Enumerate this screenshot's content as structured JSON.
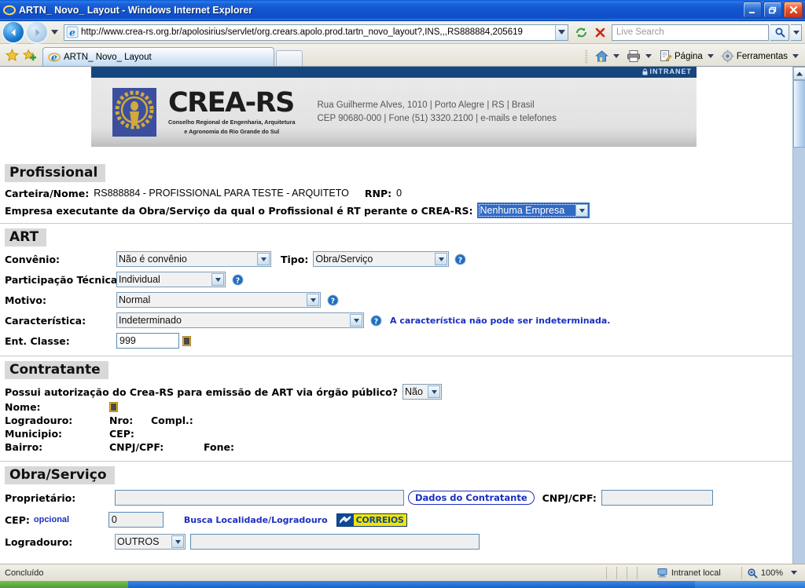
{
  "window": {
    "title": "ARTN_ Novo_ Layout - Windows Internet Explorer",
    "minimize_label": "Minimizar",
    "restore_label": "Restaurar",
    "close_label": "Fechar"
  },
  "navbar": {
    "back_label": "Voltar",
    "forward_label": "Avançar",
    "recent_label": "Páginas recentes",
    "url": "http://www.crea-rs.org.br/apolosirius/servlet/org.crears.apolo.prod.tartn_novo_layout?,INS,,,RS888884,205619",
    "refresh_label": "Atualizar",
    "stop_label": "Parar",
    "search_placeholder": "Live Search",
    "search_value": "",
    "search_go_label": "Pesquisar"
  },
  "tabbar": {
    "favorites_label": "Favoritos",
    "add_favorite_label": "Adicionar a Favoritos",
    "tab_title": "ARTN_ Novo_ Layout",
    "new_tab_label": "Nova Guia",
    "home_label": "Página Inicial",
    "print_label": "Imprimir",
    "page_menu": "Página",
    "tools_menu": "Ferramentas"
  },
  "crea_header": {
    "intranet_label": "INTRANET",
    "brand": "CREA-RS",
    "brand_sub_line1": "Conselho Regional de Engenharia, Arquitetura",
    "brand_sub_line2": "e Agronomia do Rio Grande do Sul",
    "address_line1": "Rua Guilherme Alves, 1010 | Porto Alegre | RS | Brasil",
    "address_line2": "CEP 90680-000 | Fone (51) 3320.2100 | e-mails e telefones"
  },
  "profissional": {
    "heading": "Profissional",
    "carteira_label": "Carteira/Nome:",
    "carteira_value": "RS888884  -  PROFISSIONAL PARA TESTE - ARQUITETO",
    "rnp_label": "RNP:",
    "rnp_value": "0",
    "empresa_label": "Empresa executante da Obra/Serviço da qual o Profissional é RT perante o CREA-RS:",
    "empresa_value": "Nenhuma Empresa"
  },
  "art": {
    "heading": "ART",
    "convenio_label": "Convênio:",
    "convenio_value": "Não é convênio",
    "tipo_label": "Tipo:",
    "tipo_value": "Obra/Serviço",
    "participacao_label": "Participação Técnica:",
    "participacao_value": "Individual",
    "motivo_label": "Motivo:",
    "motivo_value": "Normal",
    "caracteristica_label": "Característica:",
    "caracteristica_value": "Indeterminado",
    "caracteristica_warning": "A característica não pode ser indeterminada.",
    "ent_classe_label": "Ent. Classe:",
    "ent_classe_value": "999"
  },
  "contratante": {
    "heading": "Contratante",
    "autorizacao_label": "Possui autorização do Crea-RS para emissão de ART via órgão público?",
    "autorizacao_value": "Não",
    "nome_label": "Nome:",
    "nome_value": "",
    "logradouro_label": "Logradouro:",
    "logradouro_value": "",
    "nro_label": "Nro:",
    "nro_value": "",
    "compl_label": "Compl.:",
    "compl_value": "",
    "municipio_label": "Municipio:",
    "municipio_value": "",
    "cep_label": "CEP:",
    "cep_value": "",
    "bairro_label": "Bairro:",
    "bairro_value": "",
    "cnpjcpf_label": "CNPJ/CPF:",
    "cnpjcpf_value": "",
    "fone_label": "Fone:",
    "fone_value": ""
  },
  "obra": {
    "heading": "Obra/Serviço",
    "proprietario_label": "Proprietário:",
    "proprietario_value": "",
    "dados_contratante_button": "Dados do Contratante",
    "cnpjcpf_label": "CNPJ/CPF:",
    "cnpjcpf_value": "",
    "cep_label": "CEP:",
    "cep_optional": "opcional",
    "cep_value": "0",
    "busca_link": "Busca Localidade/Logradouro",
    "correios_label": "CORREIOS",
    "logradouro_label": "Logradouro:",
    "logradouro_tipo_value": "OUTROS",
    "logradouro_value": ""
  },
  "statusbar": {
    "status": "Concluído",
    "zone": "Intranet local",
    "zoom": "100%"
  },
  "colors": {
    "title_blue": "#1255cf",
    "crea_navy": "#17457e",
    "section_gray": "#d8d8d8",
    "link_blue": "#1b2fbf",
    "select_highlight": "#316ac5"
  }
}
